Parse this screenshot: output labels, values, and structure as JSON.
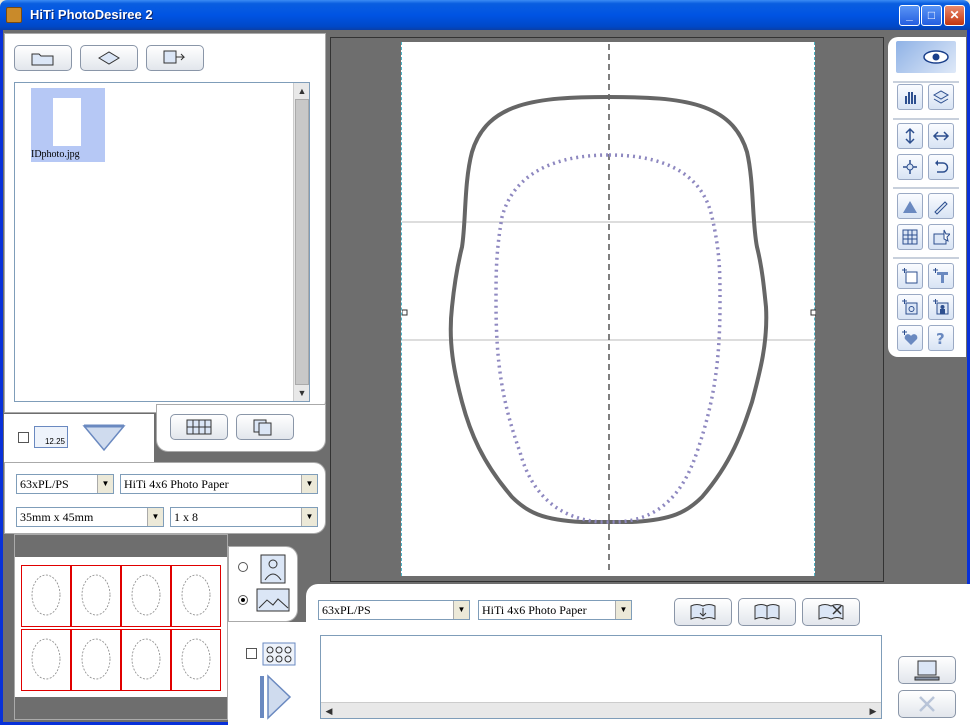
{
  "window": {
    "title": "HiTi PhotoDesiree 2",
    "controls": {
      "minimize": "_",
      "maximize": "□",
      "close": "✕"
    }
  },
  "file_list": {
    "items": [
      {
        "label": "IDphoto.jpg"
      }
    ]
  },
  "date_stamp": {
    "label": "12.25",
    "checked": false
  },
  "top_selects": {
    "printer": "63xPL/PS",
    "paper": "HiTi 4x6 Photo Paper",
    "photo_size": "35mm x 45mm",
    "layout": "1 x 8"
  },
  "orientation": {
    "portrait_selected": false,
    "landscape_selected": true
  },
  "multi_layout_checkbox": false,
  "bottom_selects": {
    "printer": "63xPL/PS",
    "paper": "HiTi 4x6 Photo Paper"
  },
  "colors": {
    "titlebar": "#0054e3",
    "frame": "#6e6e6e",
    "face_outline": "#666666",
    "face_inner_dots": "#8e88c0",
    "guide_dashed": "#4fb5c7",
    "layout_cell_border": "#e00000"
  },
  "icons": {
    "top_buttons": [
      "open-folder-icon",
      "open-album-icon",
      "export-icon"
    ],
    "right_toolbar": [
      "preview-eye-icon",
      "hand-pan-icon",
      "layers-icon",
      "flip-vertical-icon",
      "flip-horizontal-icon",
      "move-icon",
      "rotate-icon",
      "crop-icon",
      "brush-icon",
      "grid-icon",
      "stamp-icon",
      "add-frame-icon",
      "add-text-icon",
      "add-photo-icon",
      "add-person-icon",
      "add-heart-icon",
      "help-icon"
    ]
  }
}
